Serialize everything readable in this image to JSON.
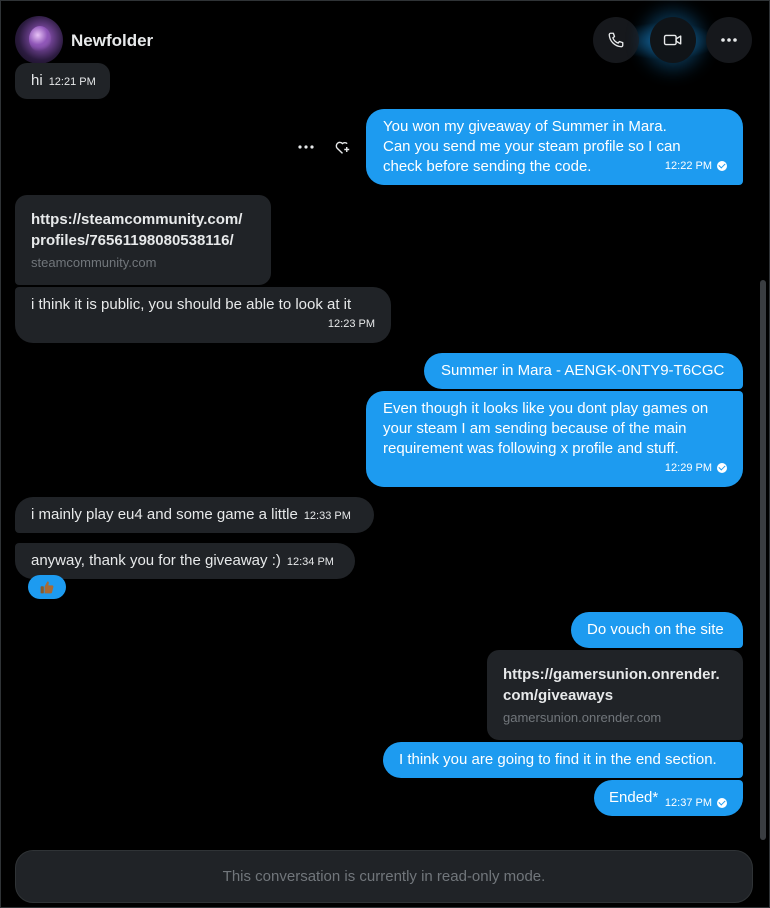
{
  "contact": {
    "name": "Newfolder"
  },
  "header": {
    "call_icon": "phone-icon",
    "video_icon": "video-icon",
    "more_icon": "more-horizontal-icon"
  },
  "messages": [
    {
      "dir": "in",
      "text": "hi",
      "time": "12:21 PM"
    },
    {
      "dir": "out",
      "lines": [
        "You won my giveaway of Summer in Mara.",
        "Can you send me your steam profile so I can",
        "check before sending the code."
      ],
      "time": "12:22 PM"
    },
    {
      "dir": "in",
      "type": "link",
      "title_lines": [
        "https://steamcommunity.com/",
        "profiles/76561198080538116/"
      ],
      "domain": "steamcommunity.com"
    },
    {
      "dir": "in",
      "text": "i think it is public, you should be able to look at it",
      "time": "12:23 PM"
    },
    {
      "dir": "out",
      "text": "Summer in Mara - AENGK-0NTY9-T6CGC"
    },
    {
      "dir": "out",
      "lines": [
        "Even though it looks like you dont play games on",
        "your steam I am sending because of the main",
        "requirement was following x profile and stuff."
      ],
      "time": "12:29 PM"
    },
    {
      "dir": "in",
      "text": "i mainly play eu4 and some game a little",
      "time": "12:33 PM"
    },
    {
      "dir": "in",
      "text": "anyway, thank you for the giveaway :)",
      "time": "12:34 PM",
      "reaction": "thumbs-up"
    },
    {
      "dir": "out",
      "text": "Do vouch on the site"
    },
    {
      "dir": "out",
      "type": "link",
      "title_lines": [
        "https://gamersunion.onrender.",
        "com/giveaways"
      ],
      "domain": "gamersunion.onrender.com"
    },
    {
      "dir": "out",
      "text": "I think you are going to find it in the end section."
    },
    {
      "dir": "out",
      "text": "Ended*",
      "time": "12:37 PM"
    }
  ],
  "footer": {
    "readonly_text": "This conversation is currently in read-only mode."
  },
  "colors": {
    "outgoing": "#1d9bf0",
    "incoming": "#202327",
    "background": "#000000"
  }
}
